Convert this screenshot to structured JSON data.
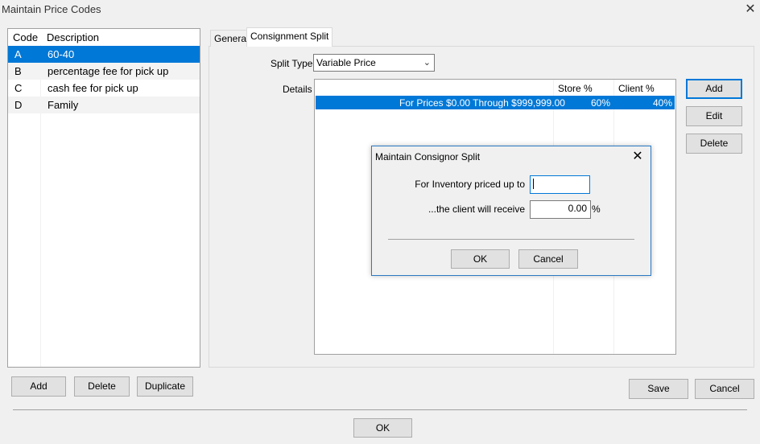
{
  "window": {
    "title": "Maintain Price Codes",
    "close_glyph": "✕"
  },
  "codes_list": {
    "headers": {
      "code": "Code",
      "description": "Description"
    },
    "rows": [
      {
        "code": "A",
        "description": "60-40"
      },
      {
        "code": "B",
        "description": "percentage fee for pick up"
      },
      {
        "code": "C",
        "description": "cash fee for pick up"
      },
      {
        "code": "D",
        "description": "Family"
      }
    ],
    "buttons": {
      "add": "Add",
      "delete": "Delete",
      "duplicate": "Duplicate"
    }
  },
  "tabs": [
    {
      "label": "General"
    },
    {
      "label": "Consignment Split"
    }
  ],
  "split": {
    "type_label": "Split Type",
    "type_value": "Variable Price",
    "details_label": "Details",
    "columns": {
      "range": "",
      "store": "Store %",
      "client": "Client %"
    },
    "rows": [
      {
        "range": "For Prices $0.00 Through $999,999.00",
        "store": "60%",
        "client": "40%"
      }
    ],
    "buttons": {
      "add": "Add",
      "edit": "Edit",
      "delete": "Delete"
    }
  },
  "dialog": {
    "title": "Maintain Consignor Split",
    "close_glyph": "✕",
    "price_label": "For Inventory priced up to",
    "price_value": "",
    "client_label": "...the client will receive",
    "client_value": "0.00",
    "percent_sign": "%",
    "ok": "OK",
    "cancel": "Cancel"
  },
  "footer": {
    "save": "Save",
    "cancel": "Cancel",
    "ok": "OK"
  }
}
